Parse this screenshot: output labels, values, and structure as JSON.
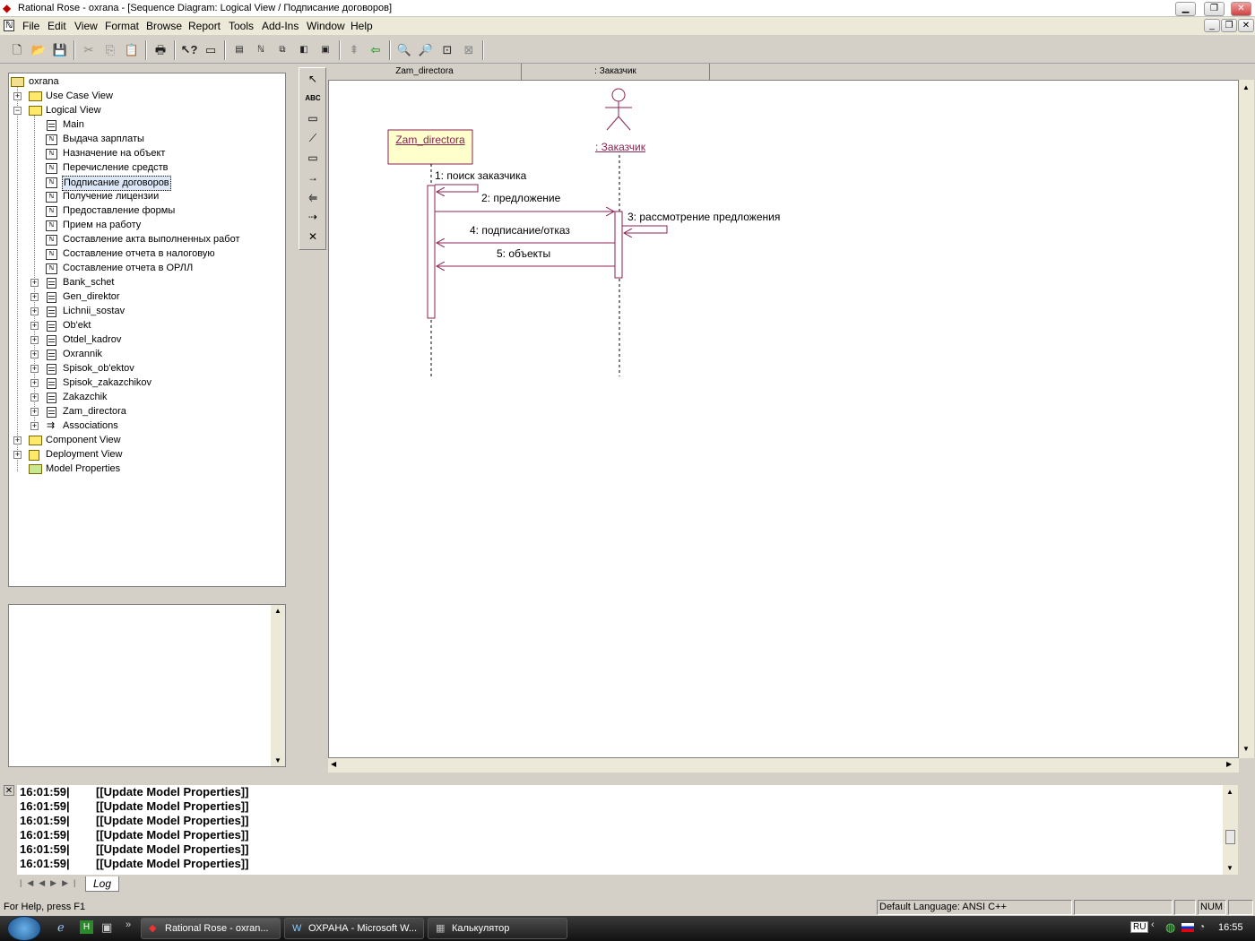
{
  "title": "Rational Rose - oxrana - [Sequence Diagram: Logical View / Подписание договоров]",
  "menu": [
    "File",
    "Edit",
    "View",
    "Format",
    "Browse",
    "Report",
    "Tools",
    "Add-Ins",
    "Window",
    "Help"
  ],
  "browser": {
    "root": "oxrana",
    "use_case_view": "Use Case View",
    "logical_view": "Logical View",
    "diagrams": [
      "Main",
      "Выдача зарплаты",
      "Назначение на объект",
      "Перечисление средств",
      "Подписание договоров",
      "Получение лицензии",
      "Предоставление формы",
      "Прием на работу",
      "Составление акта выполненных работ",
      "Составление отчета в налоговую",
      "Составление отчета в ОРЛЛ"
    ],
    "classes": [
      "Bank_schet",
      "Gen_direktor",
      "Lichnii_sostav",
      "Ob'ekt",
      "Otdel_kadrov",
      "Oxrannik",
      "Spisok_ob'ektov",
      "Spisok_zakazchikov",
      "Zakazchik",
      "Zam_directora",
      "Associations"
    ],
    "component_view": "Component View",
    "deployment_view": "Deployment View",
    "model_properties": "Model Properties"
  },
  "diagram": {
    "header_cols": [
      "Zam_directora",
      ": Заказчик"
    ],
    "object_name": "Zam_directora",
    "actor_name": ": Заказчик",
    "messages": [
      "1: поиск заказчика",
      "2: предложение",
      "3: рассмотрение предложения",
      "4: подписание/отказ",
      "5: объекты"
    ]
  },
  "log": {
    "time": "16:01:59|",
    "text": "[[Update Model Properties]]",
    "tab": "Log"
  },
  "status": {
    "help": "For Help, press F1",
    "language": "Default Language: ANSI C++",
    "num": "NUM"
  },
  "taskbar": {
    "tasks": [
      "Rational Rose - oxran...",
      "ОХРАНА - Microsoft W...",
      "Калькулятор"
    ],
    "lang": "RU",
    "clock": "16:55"
  }
}
